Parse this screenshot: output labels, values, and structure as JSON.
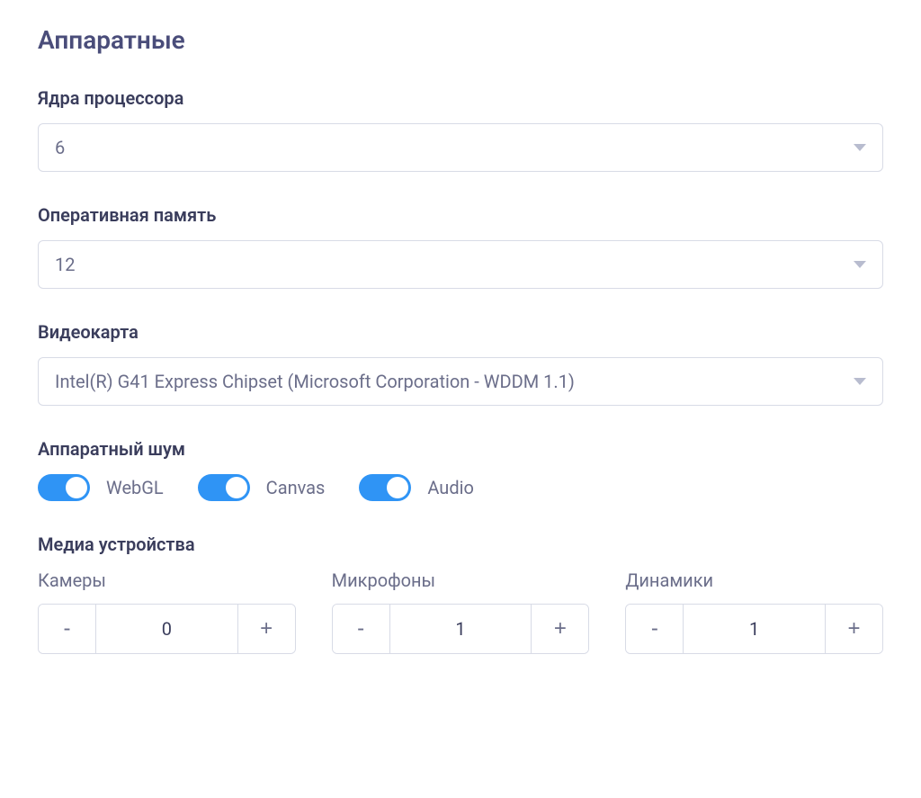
{
  "section_title": "Аппаратные",
  "cpu_cores": {
    "label": "Ядра процессора",
    "value": "6"
  },
  "ram": {
    "label": "Оперативная память",
    "value": "12"
  },
  "gpu": {
    "label": "Видеокарта",
    "value": "Intel(R) G41 Express Chipset (Microsoft Corporation - WDDM 1.1)"
  },
  "hardware_noise": {
    "label": "Аппаратный шум",
    "toggles": {
      "webgl": {
        "label": "WebGL",
        "on": true
      },
      "canvas": {
        "label": "Canvas",
        "on": true
      },
      "audio": {
        "label": "Audio",
        "on": true
      }
    }
  },
  "media_devices": {
    "label": "Медиа устройства",
    "cameras": {
      "label": "Камеры",
      "value": "0"
    },
    "microphones": {
      "label": "Микрофоны",
      "value": "1"
    },
    "speakers": {
      "label": "Динамики",
      "value": "1"
    }
  },
  "glyphs": {
    "minus": "-",
    "plus": "+"
  }
}
